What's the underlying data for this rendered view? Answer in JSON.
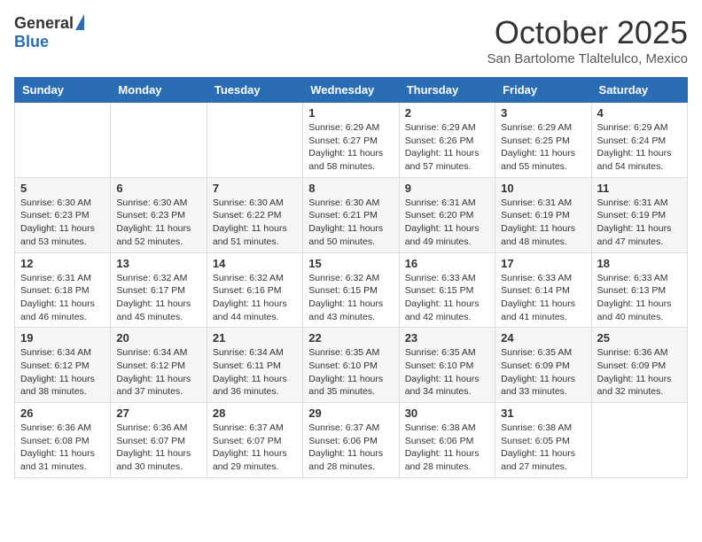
{
  "header": {
    "logo_general": "General",
    "logo_blue": "Blue",
    "month_title": "October 2025",
    "subtitle": "San Bartolome Tlaltelulco, Mexico"
  },
  "weekdays": [
    "Sunday",
    "Monday",
    "Tuesday",
    "Wednesday",
    "Thursday",
    "Friday",
    "Saturday"
  ],
  "weeks": [
    [
      {
        "day": "",
        "info": ""
      },
      {
        "day": "",
        "info": ""
      },
      {
        "day": "",
        "info": ""
      },
      {
        "day": "1",
        "info": "Sunrise: 6:29 AM\nSunset: 6:27 PM\nDaylight: 11 hours\nand 58 minutes."
      },
      {
        "day": "2",
        "info": "Sunrise: 6:29 AM\nSunset: 6:26 PM\nDaylight: 11 hours\nand 57 minutes."
      },
      {
        "day": "3",
        "info": "Sunrise: 6:29 AM\nSunset: 6:25 PM\nDaylight: 11 hours\nand 55 minutes."
      },
      {
        "day": "4",
        "info": "Sunrise: 6:29 AM\nSunset: 6:24 PM\nDaylight: 11 hours\nand 54 minutes."
      }
    ],
    [
      {
        "day": "5",
        "info": "Sunrise: 6:30 AM\nSunset: 6:23 PM\nDaylight: 11 hours\nand 53 minutes."
      },
      {
        "day": "6",
        "info": "Sunrise: 6:30 AM\nSunset: 6:23 PM\nDaylight: 11 hours\nand 52 minutes."
      },
      {
        "day": "7",
        "info": "Sunrise: 6:30 AM\nSunset: 6:22 PM\nDaylight: 11 hours\nand 51 minutes."
      },
      {
        "day": "8",
        "info": "Sunrise: 6:30 AM\nSunset: 6:21 PM\nDaylight: 11 hours\nand 50 minutes."
      },
      {
        "day": "9",
        "info": "Sunrise: 6:31 AM\nSunset: 6:20 PM\nDaylight: 11 hours\nand 49 minutes."
      },
      {
        "day": "10",
        "info": "Sunrise: 6:31 AM\nSunset: 6:19 PM\nDaylight: 11 hours\nand 48 minutes."
      },
      {
        "day": "11",
        "info": "Sunrise: 6:31 AM\nSunset: 6:19 PM\nDaylight: 11 hours\nand 47 minutes."
      }
    ],
    [
      {
        "day": "12",
        "info": "Sunrise: 6:31 AM\nSunset: 6:18 PM\nDaylight: 11 hours\nand 46 minutes."
      },
      {
        "day": "13",
        "info": "Sunrise: 6:32 AM\nSunset: 6:17 PM\nDaylight: 11 hours\nand 45 minutes."
      },
      {
        "day": "14",
        "info": "Sunrise: 6:32 AM\nSunset: 6:16 PM\nDaylight: 11 hours\nand 44 minutes."
      },
      {
        "day": "15",
        "info": "Sunrise: 6:32 AM\nSunset: 6:15 PM\nDaylight: 11 hours\nand 43 minutes."
      },
      {
        "day": "16",
        "info": "Sunrise: 6:33 AM\nSunset: 6:15 PM\nDaylight: 11 hours\nand 42 minutes."
      },
      {
        "day": "17",
        "info": "Sunrise: 6:33 AM\nSunset: 6:14 PM\nDaylight: 11 hours\nand 41 minutes."
      },
      {
        "day": "18",
        "info": "Sunrise: 6:33 AM\nSunset: 6:13 PM\nDaylight: 11 hours\nand 40 minutes."
      }
    ],
    [
      {
        "day": "19",
        "info": "Sunrise: 6:34 AM\nSunset: 6:12 PM\nDaylight: 11 hours\nand 38 minutes."
      },
      {
        "day": "20",
        "info": "Sunrise: 6:34 AM\nSunset: 6:12 PM\nDaylight: 11 hours\nand 37 minutes."
      },
      {
        "day": "21",
        "info": "Sunrise: 6:34 AM\nSunset: 6:11 PM\nDaylight: 11 hours\nand 36 minutes."
      },
      {
        "day": "22",
        "info": "Sunrise: 6:35 AM\nSunset: 6:10 PM\nDaylight: 11 hours\nand 35 minutes."
      },
      {
        "day": "23",
        "info": "Sunrise: 6:35 AM\nSunset: 6:10 PM\nDaylight: 11 hours\nand 34 minutes."
      },
      {
        "day": "24",
        "info": "Sunrise: 6:35 AM\nSunset: 6:09 PM\nDaylight: 11 hours\nand 33 minutes."
      },
      {
        "day": "25",
        "info": "Sunrise: 6:36 AM\nSunset: 6:09 PM\nDaylight: 11 hours\nand 32 minutes."
      }
    ],
    [
      {
        "day": "26",
        "info": "Sunrise: 6:36 AM\nSunset: 6:08 PM\nDaylight: 11 hours\nand 31 minutes."
      },
      {
        "day": "27",
        "info": "Sunrise: 6:36 AM\nSunset: 6:07 PM\nDaylight: 11 hours\nand 30 minutes."
      },
      {
        "day": "28",
        "info": "Sunrise: 6:37 AM\nSunset: 6:07 PM\nDaylight: 11 hours\nand 29 minutes."
      },
      {
        "day": "29",
        "info": "Sunrise: 6:37 AM\nSunset: 6:06 PM\nDaylight: 11 hours\nand 28 minutes."
      },
      {
        "day": "30",
        "info": "Sunrise: 6:38 AM\nSunset: 6:06 PM\nDaylight: 11 hours\nand 28 minutes."
      },
      {
        "day": "31",
        "info": "Sunrise: 6:38 AM\nSunset: 6:05 PM\nDaylight: 11 hours\nand 27 minutes."
      },
      {
        "day": "",
        "info": ""
      }
    ]
  ]
}
